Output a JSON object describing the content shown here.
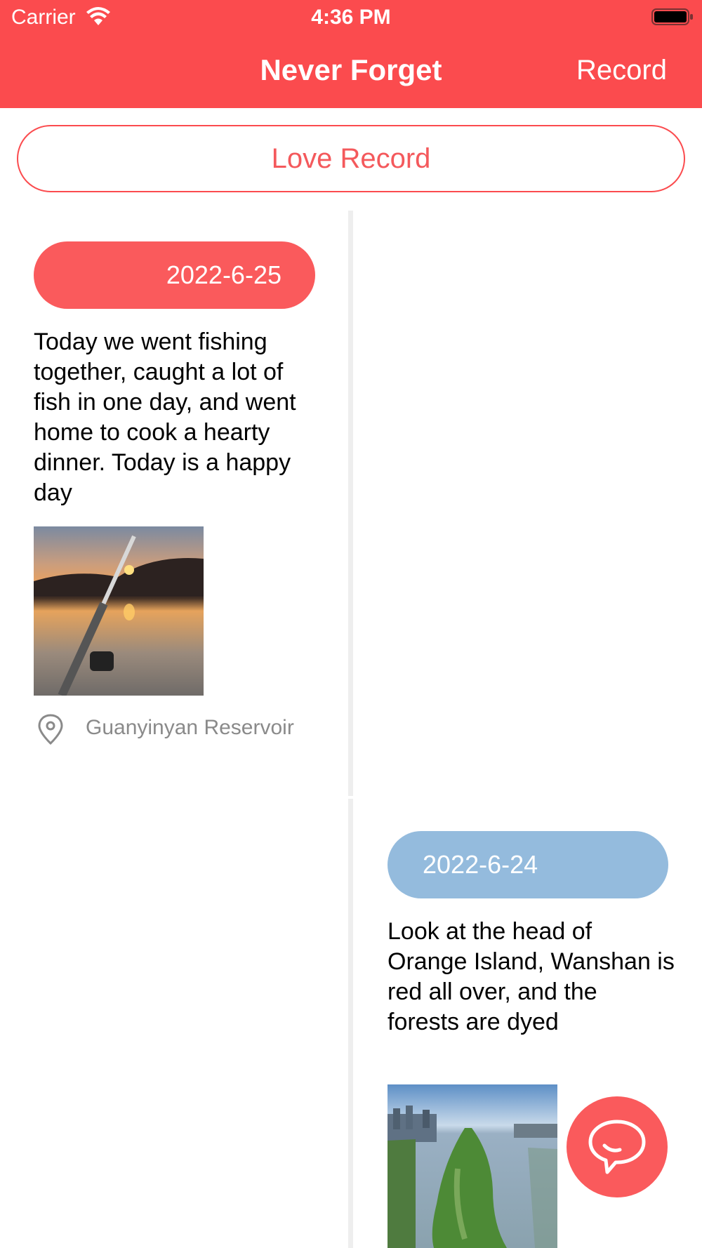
{
  "status_bar": {
    "carrier": "Carrier",
    "time": "4:36 PM",
    "icons": [
      "wifi-icon",
      "battery-icon"
    ]
  },
  "header": {
    "title": "Never Forget",
    "record_label": "Record",
    "background": "#fb4b4e"
  },
  "love_record_label": "Love Record",
  "entries": [
    {
      "date": "2022-6-25",
      "date_color": "#fa5a5c",
      "text": "Today we went fishing together, caught a lot of fish in one day, and went home to cook a hearty dinner. Today is a happy day",
      "location": "Guanyinyan Reservoir"
    },
    {
      "date": "2022-6-24",
      "date_color": "#94bbdd",
      "text": "Look at the head of Orange Island, Wanshan is red all over, and the forests are dyed"
    }
  ],
  "fab_icon": "chat-bubble-icon"
}
